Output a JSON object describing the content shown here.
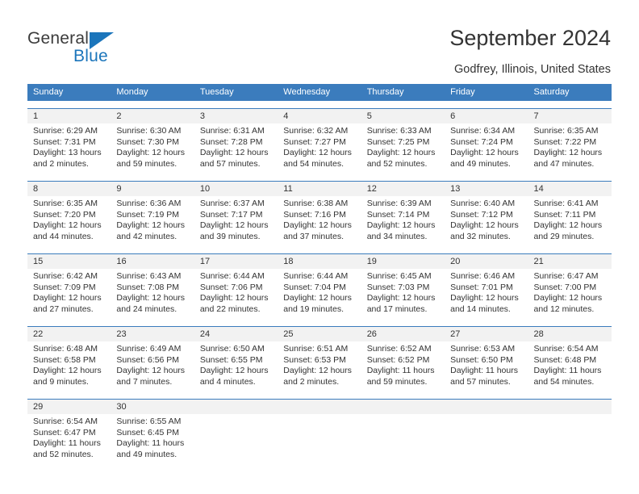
{
  "logo": {
    "word1": "General",
    "word2": "Blue",
    "triangle_color": "#1b75bb",
    "text_color": "#3c3c3c"
  },
  "header": {
    "title": "September 2024",
    "subtitle": "Godfrey, Illinois, United States"
  },
  "theme": {
    "header_band": "#3b7cbd",
    "daynum_band": "#f2f2f2",
    "text": "#333333"
  },
  "weekdays": [
    "Sunday",
    "Monday",
    "Tuesday",
    "Wednesday",
    "Thursday",
    "Friday",
    "Saturday"
  ],
  "weeks": [
    {
      "days": [
        {
          "day": "1",
          "sunrise": "Sunrise: 6:29 AM",
          "sunset": "Sunset: 7:31 PM",
          "daylight1": "Daylight: 13 hours",
          "daylight2": "and 2 minutes."
        },
        {
          "day": "2",
          "sunrise": "Sunrise: 6:30 AM",
          "sunset": "Sunset: 7:30 PM",
          "daylight1": "Daylight: 12 hours",
          "daylight2": "and 59 minutes."
        },
        {
          "day": "3",
          "sunrise": "Sunrise: 6:31 AM",
          "sunset": "Sunset: 7:28 PM",
          "daylight1": "Daylight: 12 hours",
          "daylight2": "and 57 minutes."
        },
        {
          "day": "4",
          "sunrise": "Sunrise: 6:32 AM",
          "sunset": "Sunset: 7:27 PM",
          "daylight1": "Daylight: 12 hours",
          "daylight2": "and 54 minutes."
        },
        {
          "day": "5",
          "sunrise": "Sunrise: 6:33 AM",
          "sunset": "Sunset: 7:25 PM",
          "daylight1": "Daylight: 12 hours",
          "daylight2": "and 52 minutes."
        },
        {
          "day": "6",
          "sunrise": "Sunrise: 6:34 AM",
          "sunset": "Sunset: 7:24 PM",
          "daylight1": "Daylight: 12 hours",
          "daylight2": "and 49 minutes."
        },
        {
          "day": "7",
          "sunrise": "Sunrise: 6:35 AM",
          "sunset": "Sunset: 7:22 PM",
          "daylight1": "Daylight: 12 hours",
          "daylight2": "and 47 minutes."
        }
      ]
    },
    {
      "days": [
        {
          "day": "8",
          "sunrise": "Sunrise: 6:35 AM",
          "sunset": "Sunset: 7:20 PM",
          "daylight1": "Daylight: 12 hours",
          "daylight2": "and 44 minutes."
        },
        {
          "day": "9",
          "sunrise": "Sunrise: 6:36 AM",
          "sunset": "Sunset: 7:19 PM",
          "daylight1": "Daylight: 12 hours",
          "daylight2": "and 42 minutes."
        },
        {
          "day": "10",
          "sunrise": "Sunrise: 6:37 AM",
          "sunset": "Sunset: 7:17 PM",
          "daylight1": "Daylight: 12 hours",
          "daylight2": "and 39 minutes."
        },
        {
          "day": "11",
          "sunrise": "Sunrise: 6:38 AM",
          "sunset": "Sunset: 7:16 PM",
          "daylight1": "Daylight: 12 hours",
          "daylight2": "and 37 minutes."
        },
        {
          "day": "12",
          "sunrise": "Sunrise: 6:39 AM",
          "sunset": "Sunset: 7:14 PM",
          "daylight1": "Daylight: 12 hours",
          "daylight2": "and 34 minutes."
        },
        {
          "day": "13",
          "sunrise": "Sunrise: 6:40 AM",
          "sunset": "Sunset: 7:12 PM",
          "daylight1": "Daylight: 12 hours",
          "daylight2": "and 32 minutes."
        },
        {
          "day": "14",
          "sunrise": "Sunrise: 6:41 AM",
          "sunset": "Sunset: 7:11 PM",
          "daylight1": "Daylight: 12 hours",
          "daylight2": "and 29 minutes."
        }
      ]
    },
    {
      "days": [
        {
          "day": "15",
          "sunrise": "Sunrise: 6:42 AM",
          "sunset": "Sunset: 7:09 PM",
          "daylight1": "Daylight: 12 hours",
          "daylight2": "and 27 minutes."
        },
        {
          "day": "16",
          "sunrise": "Sunrise: 6:43 AM",
          "sunset": "Sunset: 7:08 PM",
          "daylight1": "Daylight: 12 hours",
          "daylight2": "and 24 minutes."
        },
        {
          "day": "17",
          "sunrise": "Sunrise: 6:44 AM",
          "sunset": "Sunset: 7:06 PM",
          "daylight1": "Daylight: 12 hours",
          "daylight2": "and 22 minutes."
        },
        {
          "day": "18",
          "sunrise": "Sunrise: 6:44 AM",
          "sunset": "Sunset: 7:04 PM",
          "daylight1": "Daylight: 12 hours",
          "daylight2": "and 19 minutes."
        },
        {
          "day": "19",
          "sunrise": "Sunrise: 6:45 AM",
          "sunset": "Sunset: 7:03 PM",
          "daylight1": "Daylight: 12 hours",
          "daylight2": "and 17 minutes."
        },
        {
          "day": "20",
          "sunrise": "Sunrise: 6:46 AM",
          "sunset": "Sunset: 7:01 PM",
          "daylight1": "Daylight: 12 hours",
          "daylight2": "and 14 minutes."
        },
        {
          "day": "21",
          "sunrise": "Sunrise: 6:47 AM",
          "sunset": "Sunset: 7:00 PM",
          "daylight1": "Daylight: 12 hours",
          "daylight2": "and 12 minutes."
        }
      ]
    },
    {
      "days": [
        {
          "day": "22",
          "sunrise": "Sunrise: 6:48 AM",
          "sunset": "Sunset: 6:58 PM",
          "daylight1": "Daylight: 12 hours",
          "daylight2": "and 9 minutes."
        },
        {
          "day": "23",
          "sunrise": "Sunrise: 6:49 AM",
          "sunset": "Sunset: 6:56 PM",
          "daylight1": "Daylight: 12 hours",
          "daylight2": "and 7 minutes."
        },
        {
          "day": "24",
          "sunrise": "Sunrise: 6:50 AM",
          "sunset": "Sunset: 6:55 PM",
          "daylight1": "Daylight: 12 hours",
          "daylight2": "and 4 minutes."
        },
        {
          "day": "25",
          "sunrise": "Sunrise: 6:51 AM",
          "sunset": "Sunset: 6:53 PM",
          "daylight1": "Daylight: 12 hours",
          "daylight2": "and 2 minutes."
        },
        {
          "day": "26",
          "sunrise": "Sunrise: 6:52 AM",
          "sunset": "Sunset: 6:52 PM",
          "daylight1": "Daylight: 11 hours",
          "daylight2": "and 59 minutes."
        },
        {
          "day": "27",
          "sunrise": "Sunrise: 6:53 AM",
          "sunset": "Sunset: 6:50 PM",
          "daylight1": "Daylight: 11 hours",
          "daylight2": "and 57 minutes."
        },
        {
          "day": "28",
          "sunrise": "Sunrise: 6:54 AM",
          "sunset": "Sunset: 6:48 PM",
          "daylight1": "Daylight: 11 hours",
          "daylight2": "and 54 minutes."
        }
      ]
    },
    {
      "days": [
        {
          "day": "29",
          "sunrise": "Sunrise: 6:54 AM",
          "sunset": "Sunset: 6:47 PM",
          "daylight1": "Daylight: 11 hours",
          "daylight2": "and 52 minutes."
        },
        {
          "day": "30",
          "sunrise": "Sunrise: 6:55 AM",
          "sunset": "Sunset: 6:45 PM",
          "daylight1": "Daylight: 11 hours",
          "daylight2": "and 49 minutes."
        },
        {
          "day": "",
          "sunrise": "",
          "sunset": "",
          "daylight1": "",
          "daylight2": ""
        },
        {
          "day": "",
          "sunrise": "",
          "sunset": "",
          "daylight1": "",
          "daylight2": ""
        },
        {
          "day": "",
          "sunrise": "",
          "sunset": "",
          "daylight1": "",
          "daylight2": ""
        },
        {
          "day": "",
          "sunrise": "",
          "sunset": "",
          "daylight1": "",
          "daylight2": ""
        },
        {
          "day": "",
          "sunrise": "",
          "sunset": "",
          "daylight1": "",
          "daylight2": ""
        }
      ]
    }
  ]
}
